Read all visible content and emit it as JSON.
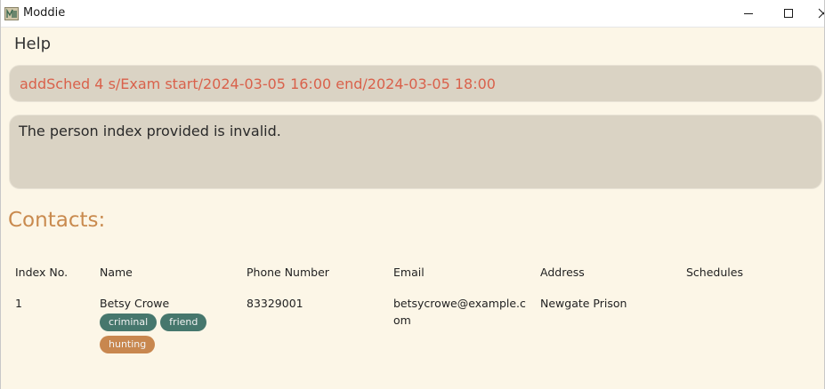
{
  "window": {
    "title": "Moddie",
    "icon": "app-icon"
  },
  "menu": {
    "help_label": "Help"
  },
  "command_box": {
    "value": "addSched 4 s/Exam start/2024-03-05 16:00 end/2024-03-05 18:00",
    "color": "#d9614b"
  },
  "result_box": {
    "message": "The person index provided is invalid."
  },
  "contacts": {
    "heading": "Contacts:",
    "heading_color": "#c98a4e",
    "columns": {
      "index": "Index No.",
      "name": "Name",
      "phone": "Phone Number",
      "email": "Email",
      "address": "Address",
      "schedules": "Schedules"
    },
    "rows": [
      {
        "index": "1",
        "name": "Betsy Crowe",
        "tags": [
          {
            "label": "criminal",
            "color": "#46776d"
          },
          {
            "label": "friend",
            "color": "#46776d"
          },
          {
            "label": "hunting",
            "color": "#c8874f"
          }
        ],
        "phone": "83329001",
        "email": "betsycrowe@example.com",
        "address": "Newgate Prison",
        "schedules": ""
      }
    ]
  }
}
